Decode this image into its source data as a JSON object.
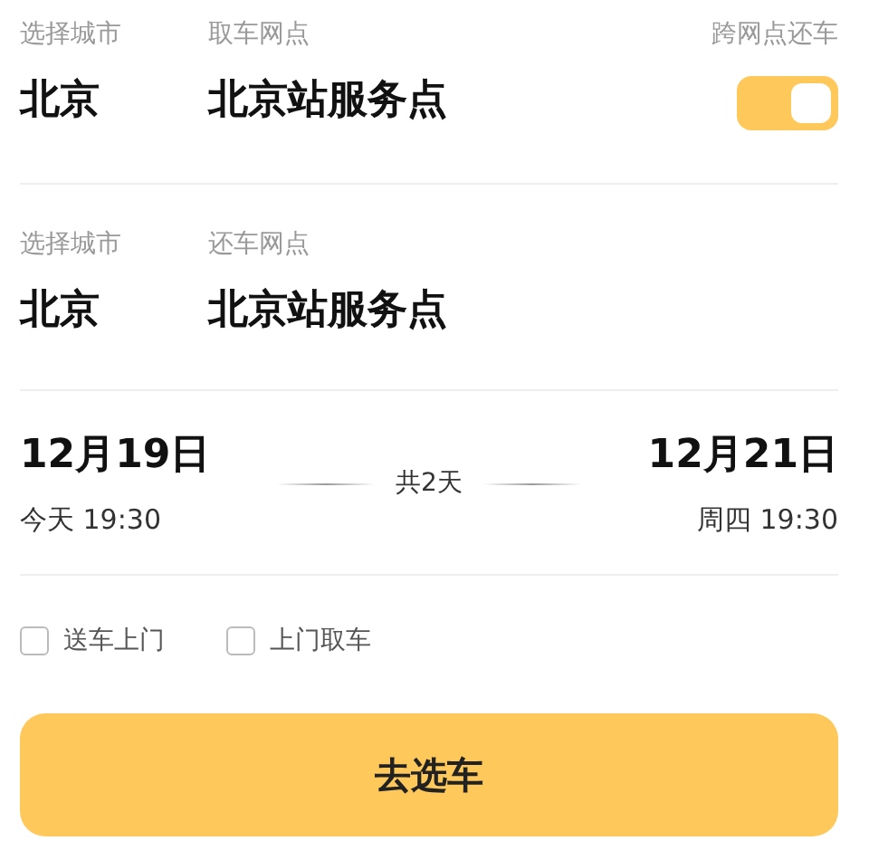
{
  "pickup": {
    "city_label": "选择城市",
    "city": "北京",
    "point_label": "取车网点",
    "point": "北京站服务点",
    "toggle_label": "跨网点还车",
    "cross_return_on": true
  },
  "return": {
    "city_label": "选择城市",
    "city": "北京",
    "point_label": "还车网点",
    "point": "北京站服务点"
  },
  "dates": {
    "start_date": "12月19日",
    "start_time": "今天 19:30",
    "duration": "共2天",
    "end_date": "12月21日",
    "end_time": "周四 19:30"
  },
  "options": [
    {
      "label": "送车上门",
      "checked": false
    },
    {
      "label": "上门取车",
      "checked": false
    }
  ],
  "submit_button": "去选车"
}
